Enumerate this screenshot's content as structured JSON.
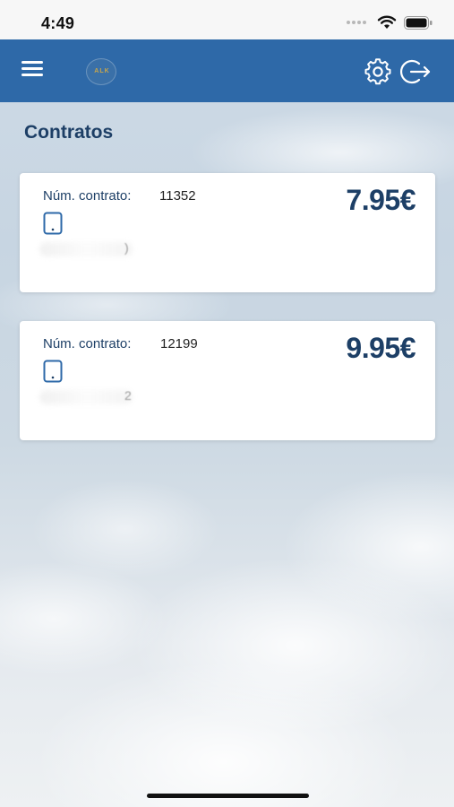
{
  "status_bar": {
    "time": "4:49",
    "icons": [
      "signal-dots-icon",
      "wifi-icon",
      "battery-icon"
    ]
  },
  "header": {
    "menu_icon": "hamburger-menu-icon",
    "logo_text": "ALK",
    "actions": [
      "gear-icon",
      "logout-icon"
    ],
    "background_color": "#2e69a8"
  },
  "page": {
    "title": "Contratos"
  },
  "contracts": [
    {
      "label": "Núm. contrato:",
      "number": "11352",
      "price": "7.95€",
      "device_icon": "smartphone-icon",
      "blurred_tail": ")"
    },
    {
      "label": "Núm. contrato:",
      "number": "12199",
      "price": "9.95€",
      "device_icon": "smartphone-icon",
      "blurred_tail": "2"
    }
  ],
  "colors": {
    "accent": "#2e69a8",
    "title_text": "#1d3f66"
  }
}
